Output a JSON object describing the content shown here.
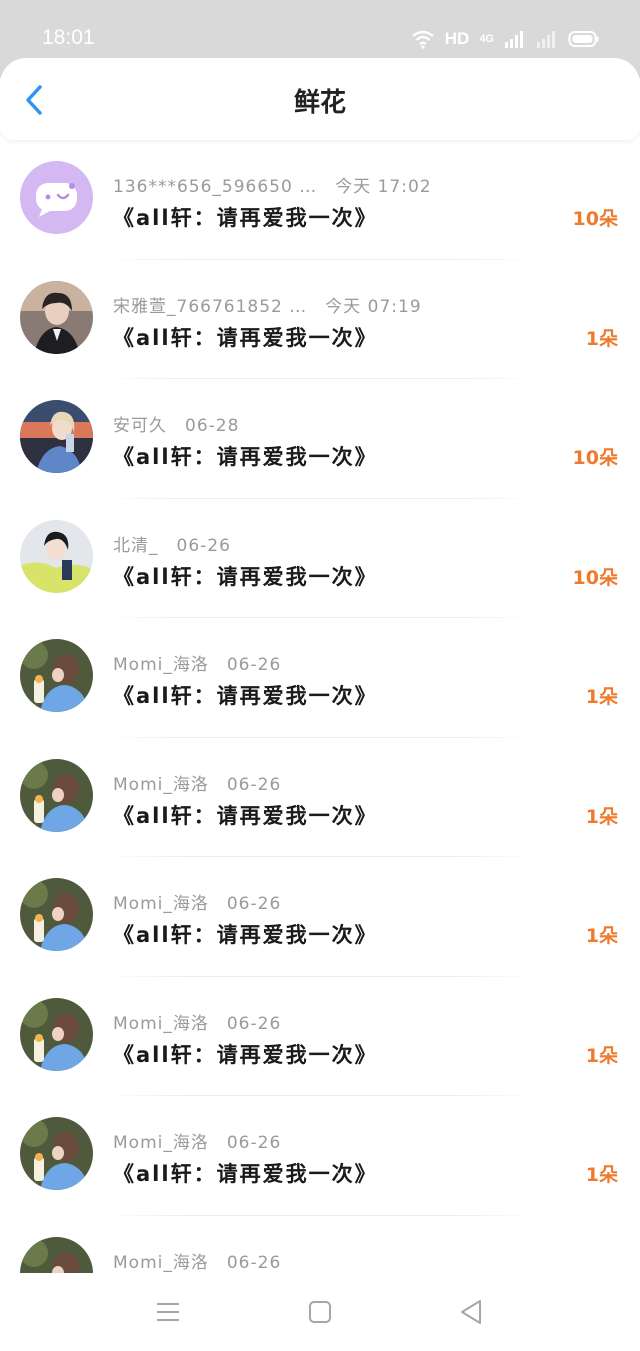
{
  "status_bar": {
    "time": "18:01",
    "network": "HD",
    "signal": "4G"
  },
  "header": {
    "title": "鲜花"
  },
  "colors": {
    "accent": "#2f93f0",
    "count": "#f07a2c",
    "meta": "#9a9a9a"
  },
  "items": [
    {
      "username": "136***656_596650 …",
      "time": "今天 17:02",
      "message": "《all轩：请再爱我一次》",
      "count": "10朵",
      "avatar": "bubble-icon"
    },
    {
      "username": "宋雅萱_766761852 …",
      "time": "今天 07:19",
      "message": "《all轩：请再爱我一次》",
      "count": "1朵",
      "avatar": "portrait-dark"
    },
    {
      "username": "安可久",
      "time": "06-28",
      "message": "《all轩：请再爱我一次》",
      "count": "10朵",
      "avatar": "portrait-sunset"
    },
    {
      "username": "北清_",
      "time": "06-26",
      "message": "《all轩：请再爱我一次》",
      "count": "10朵",
      "avatar": "portrait-yellow"
    },
    {
      "username": "Momi_海洛",
      "time": "06-26",
      "message": "《all轩：请再爱我一次》",
      "count": "1朵",
      "avatar": "portrait-girl"
    },
    {
      "username": "Momi_海洛",
      "time": "06-26",
      "message": "《all轩：请再爱我一次》",
      "count": "1朵",
      "avatar": "portrait-girl"
    },
    {
      "username": "Momi_海洛",
      "time": "06-26",
      "message": "《all轩：请再爱我一次》",
      "count": "1朵",
      "avatar": "portrait-girl"
    },
    {
      "username": "Momi_海洛",
      "time": "06-26",
      "message": "《all轩：请再爱我一次》",
      "count": "1朵",
      "avatar": "portrait-girl"
    },
    {
      "username": "Momi_海洛",
      "time": "06-26",
      "message": "《all轩：请再爱我一次》",
      "count": "1朵",
      "avatar": "portrait-girl"
    },
    {
      "username": "Momi_海洛",
      "time": "06-26",
      "message": "",
      "count": "",
      "avatar": "portrait-girl"
    }
  ]
}
